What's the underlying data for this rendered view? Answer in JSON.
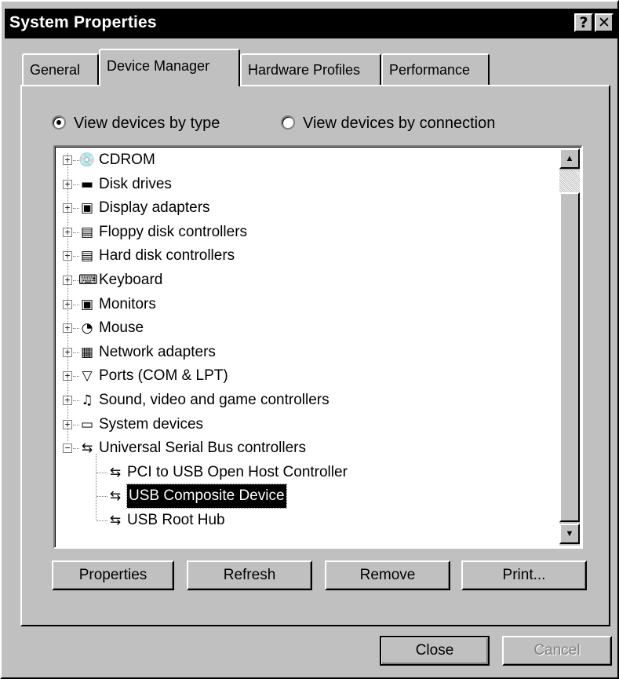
{
  "window": {
    "title": "System Properties",
    "help_glyph": "?",
    "close_glyph": "✕"
  },
  "tabs": [
    {
      "label": "General",
      "active": false
    },
    {
      "label": "Device Manager",
      "active": true
    },
    {
      "label": "Hardware Profiles",
      "active": false
    },
    {
      "label": "Performance",
      "active": false
    }
  ],
  "view_options": {
    "by_type": "View devices by type",
    "by_connection": "View devices by connection",
    "selected": "by_type"
  },
  "device_tree": {
    "categories": [
      {
        "label": "CDROM",
        "icon": "cdrom-icon",
        "expander": "+"
      },
      {
        "label": "Disk drives",
        "icon": "disk-drive-icon",
        "expander": "+"
      },
      {
        "label": "Display adapters",
        "icon": "display-adapter-icon",
        "expander": "+"
      },
      {
        "label": "Floppy disk controllers",
        "icon": "floppy-controller-icon",
        "expander": "+"
      },
      {
        "label": "Hard disk controllers",
        "icon": "hard-disk-controller-icon",
        "expander": "+"
      },
      {
        "label": "Keyboard",
        "icon": "keyboard-icon",
        "expander": "+"
      },
      {
        "label": "Monitors",
        "icon": "monitor-icon",
        "expander": "+"
      },
      {
        "label": "Mouse",
        "icon": "mouse-icon",
        "expander": "+"
      },
      {
        "label": "Network adapters",
        "icon": "network-adapter-icon",
        "expander": "+"
      },
      {
        "label": "Ports (COM & LPT)",
        "icon": "port-icon",
        "expander": "+"
      },
      {
        "label": "Sound, video and game controllers",
        "icon": "sound-icon",
        "expander": "+"
      },
      {
        "label": "System devices",
        "icon": "system-device-icon",
        "expander": "+"
      },
      {
        "label": "Universal Serial Bus controllers",
        "icon": "usb-icon",
        "expander": "−"
      }
    ],
    "usb_children": [
      {
        "label": "PCI to USB Open Host Controller",
        "icon": "usb-icon",
        "selected": false
      },
      {
        "label": "USB Composite Device",
        "icon": "usb-icon",
        "selected": true
      },
      {
        "label": "USB Root Hub",
        "icon": "usb-icon",
        "selected": false
      }
    ]
  },
  "scrollbar": {
    "up_glyph": "▲",
    "down_glyph": "▼"
  },
  "panel_buttons": {
    "properties": "Properties",
    "refresh": "Refresh",
    "remove": "Remove",
    "print": "Print..."
  },
  "dialog_buttons": {
    "close": "Close",
    "cancel": "Cancel"
  }
}
